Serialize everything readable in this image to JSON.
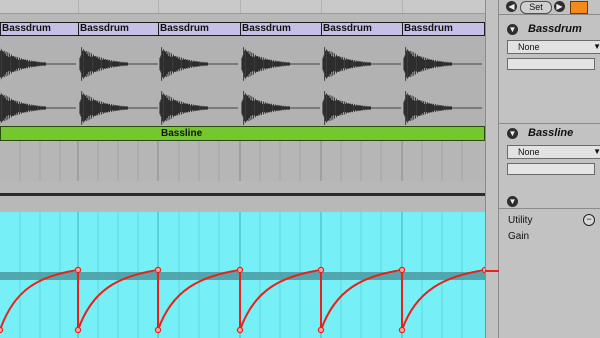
{
  "transport": {
    "set_label": "Set",
    "prev_icon": "left-arrow",
    "next_icon": "right-arrow",
    "lock_icon": "lock"
  },
  "tracks": [
    {
      "name": "Bassdrum",
      "clip_labels": [
        "Bassdrum",
        "Bassdrum",
        "Bassdrum",
        "Bassdrum",
        "Bassdrum",
        "Bassdrum"
      ],
      "clip_color": "#c7bfe6"
    },
    {
      "name": "Bassline",
      "clip_labels": [
        "Bassline"
      ],
      "clip_color": "#74c82e"
    }
  ],
  "inspector": {
    "bassdrum": {
      "title": "Bassdrum",
      "input": "None"
    },
    "bassline": {
      "title": "Bassline",
      "input": "None"
    },
    "automation": {
      "device": "Utility",
      "parameter": "Gain"
    }
  },
  "colors": {
    "automation_lane": "#76f0f6",
    "automation_curve": "#e8221b"
  }
}
